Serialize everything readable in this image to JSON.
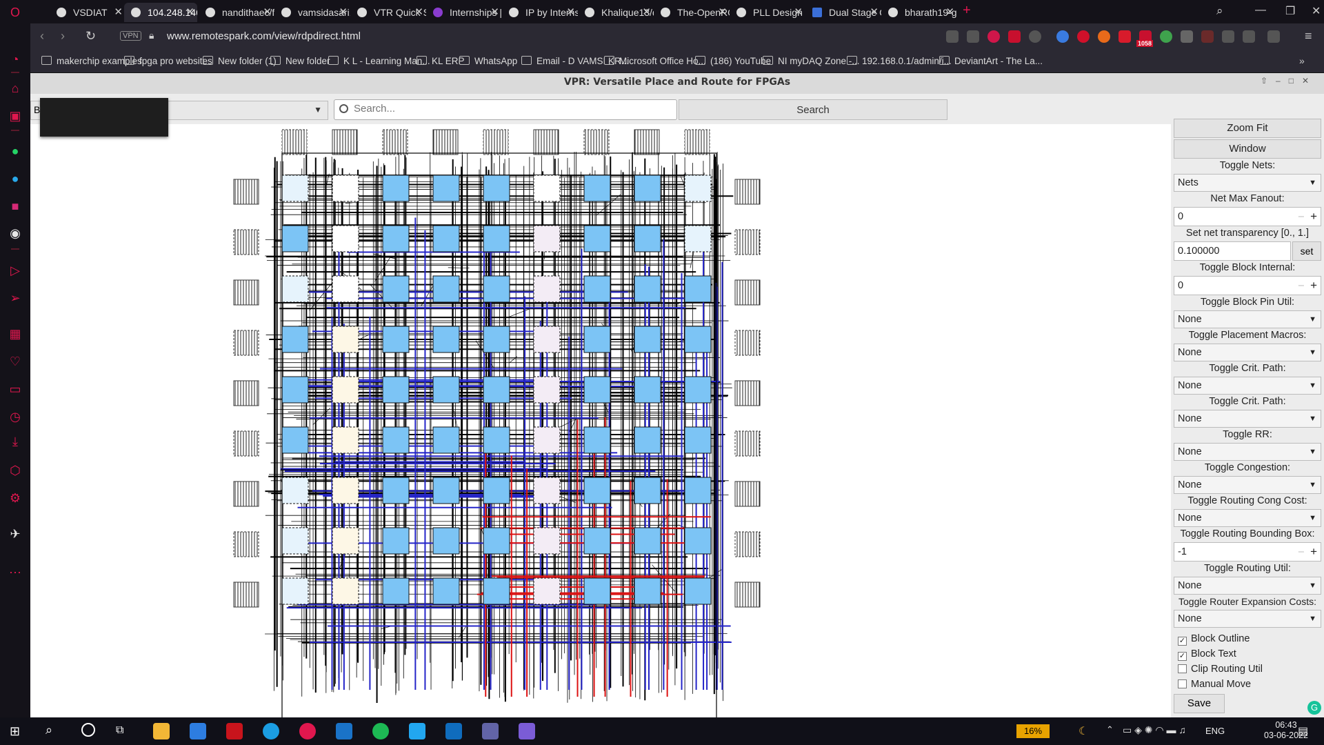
{
  "browser": {
    "tabs": [
      {
        "label": "VSDIAT",
        "active": false
      },
      {
        "label": "104.248.146.",
        "active": true
      },
      {
        "label": "nandithaec/f",
        "active": false
      },
      {
        "label": "vamsidasari1",
        "active": false
      },
      {
        "label": "VTR Quick St",
        "active": false
      },
      {
        "label": "Internships |",
        "active": false
      },
      {
        "label": "IP by Interns",
        "active": false
      },
      {
        "label": "Khalique13/d",
        "active": false
      },
      {
        "label": "The-OpenRO",
        "active": false
      },
      {
        "label": "PLL Design u",
        "active": false
      },
      {
        "label": "Dual Stage C",
        "active": false
      },
      {
        "label": "bharath19-g",
        "active": false
      }
    ],
    "url": "www.remotespark.com/view/rdpdirect.html",
    "vpn_label": "VPN",
    "extension_badge": "1058",
    "bookmarks": [
      "makerchip examples",
      "fpga pro websites",
      "New folder (1)",
      "New folder",
      "K L - Learning Man...",
      "KL ERP",
      "WhatsApp",
      "Email - D VAMSI KR...",
      "Microsoft Office Ho...",
      "(186) YouTube",
      "NI myDAQ Zone -...",
      "192.168.0.1/admin/i...",
      "DeviantArt - The La..."
    ]
  },
  "vpr": {
    "title": "VPR: Versatile Place and Route for FPGAs",
    "combo_value": "B",
    "search_placeholder": "Search...",
    "search_button": "Search",
    "panel": {
      "zoom_fit": "Zoom Fit",
      "window": "Window",
      "toggle_nets_label": "Toggle Nets:",
      "toggle_nets_value": "Nets",
      "net_max_fanout_label": "Net Max Fanout:",
      "net_max_fanout_value": "0",
      "net_transparency_label": "Set net transparency [0., 1.]",
      "net_transparency_value": "0.100000",
      "set_button": "set",
      "block_internal_label": "Toggle Block Internal:",
      "block_internal_value": "0",
      "block_pin_util_label": "Toggle Block Pin Util:",
      "block_pin_util_value": "None",
      "placement_macros_label": "Toggle Placement Macros:",
      "placement_macros_value": "None",
      "crit_path_label_1": "Toggle Crit. Path:",
      "crit_path_value_1": "None",
      "crit_path_label_2": "Toggle Crit. Path:",
      "crit_path_value_2": "None",
      "rr_label": "Toggle RR:",
      "rr_value": "None",
      "congestion_label": "Toggle Congestion:",
      "congestion_value": "None",
      "routing_cong_cost_label": "Toggle Routing Cong Cost:",
      "routing_cong_cost_value": "None",
      "routing_bbox_label": "Toggle Routing Bounding Box:",
      "routing_bbox_value": "-1",
      "routing_util_label": "Toggle Routing Util:",
      "routing_util_value": "None",
      "router_expansion_label": "Toggle Router Expansion Costs:",
      "router_expansion_value": "None",
      "block_outline": {
        "label": "Block Outline",
        "checked": true
      },
      "block_text": {
        "label": "Block Text",
        "checked": true
      },
      "clip_routing_util": {
        "label": "Clip Routing Util",
        "checked": false
      },
      "manual_move": {
        "label": "Manual Move",
        "checked": false
      },
      "save": "Save"
    }
  },
  "taskbar": {
    "battery": "16%",
    "language": "ENG",
    "time": "06:43",
    "date": "03-06-2022"
  },
  "colors": {
    "clb_fill": "#7cc4f5",
    "clb_light": "#e6f3fc",
    "route_blue": "#2424c8",
    "route_red": "#dd1111",
    "opera_red": "#e0174e"
  }
}
